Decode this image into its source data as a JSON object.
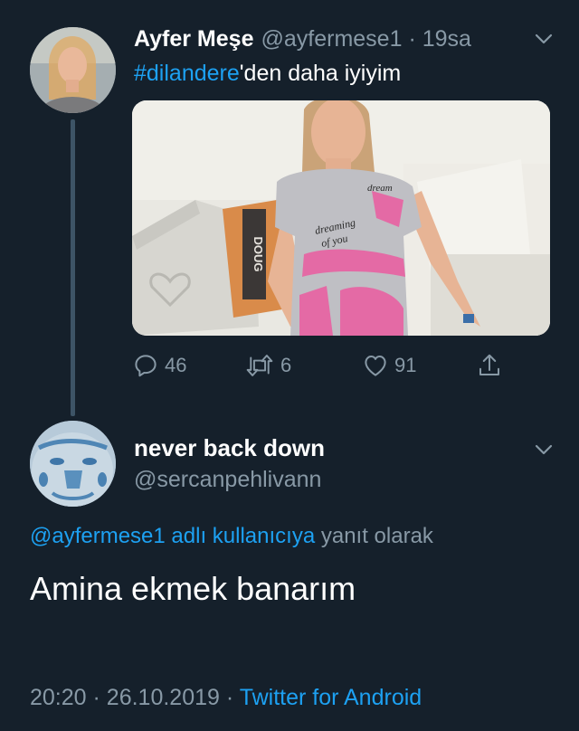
{
  "tweet": {
    "author_name": "Ayfer Meşe",
    "author_handle": "@ayfermese1",
    "separator": "·",
    "time_ago": "19sa",
    "hashtag": "#dilandere",
    "text_rest": "'den daha iyiyim",
    "photo_text": {
      "shirt_top": "dream",
      "shirt_mid": "dreaming",
      "shirt_low": "of you",
      "pillow": "DOUG"
    },
    "stats": {
      "replies": "46",
      "retweets": "6",
      "likes": "91"
    },
    "icons": [
      "reply-icon",
      "retweet-icon",
      "like-icon",
      "share-icon",
      "chevron-down-icon"
    ]
  },
  "reply": {
    "author_name": "never back down",
    "author_handle": "@sercanpehlivann",
    "reply_to_link": "@ayfermese1 adlı kullanıcıya",
    "reply_to_rest": "yanıt olarak",
    "text": "Amina ekmek banarım",
    "time": "20:20",
    "separator": "·",
    "date": "26.10.2019",
    "separator2": "·",
    "source": "Twitter for Android"
  },
  "colors": {
    "background": "#15202b",
    "accent": "#1da1f2",
    "muted": "#8899a6",
    "thread_line": "#3d5466"
  }
}
